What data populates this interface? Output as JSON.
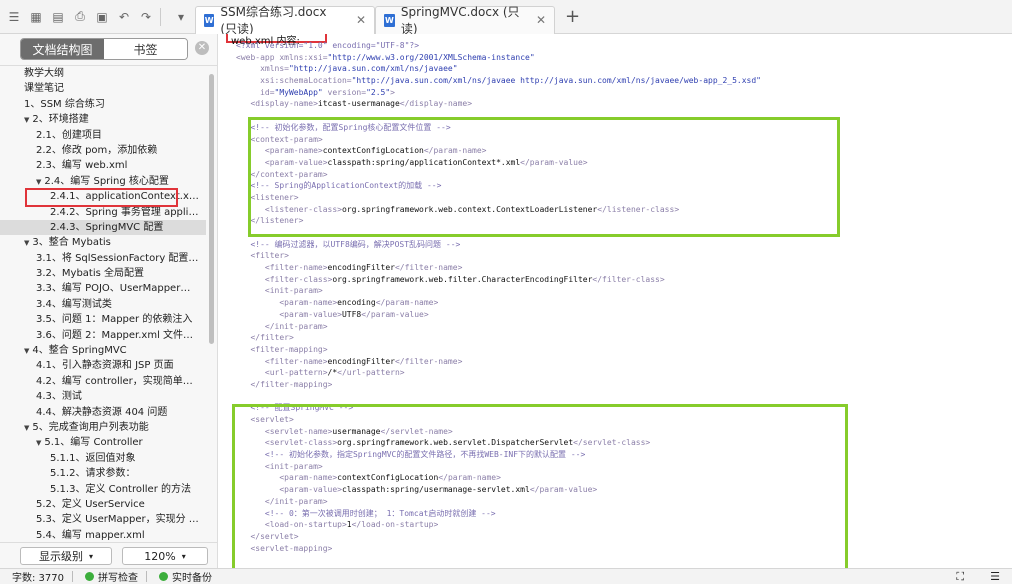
{
  "tabs": [
    {
      "label": "SSM综合练习.docx (只读)",
      "active": true
    },
    {
      "label": "SpringMVC.docx (只读)",
      "active": false
    }
  ],
  "sidebar": {
    "seg_outline": "文档结构图",
    "seg_bookmarks": "书签",
    "items": [
      {
        "label": "教学大纲",
        "level": 0,
        "caret": ""
      },
      {
        "label": "课堂笔记",
        "level": 0,
        "caret": ""
      },
      {
        "label": "1、SSM 综合练习",
        "level": 0,
        "caret": ""
      },
      {
        "label": "2、环境搭建",
        "level": 0,
        "caret": "▼"
      },
      {
        "label": "2.1、创建项目",
        "level": 1,
        "caret": ""
      },
      {
        "label": "2.2、修改 pom，添加依赖",
        "level": 1,
        "caret": ""
      },
      {
        "label": "2.3、编写 web.xml",
        "level": 1,
        "caret": ""
      },
      {
        "label": "2.4、编写 Spring 核心配置",
        "level": 1,
        "caret": "▼"
      },
      {
        "label": "2.4.1、applicationContext.xml",
        "level": 2,
        "caret": ""
      },
      {
        "label": "2.4.2、Spring 事务管理 applic…",
        "level": 2,
        "caret": ""
      },
      {
        "label": "2.4.3、SpringMVC 配置",
        "level": 2,
        "caret": "",
        "selected": true
      },
      {
        "label": "3、整合 Mybatis",
        "level": 0,
        "caret": "▼"
      },
      {
        "label": "3.1、将 SqlSessionFactory 配置 …",
        "level": 1,
        "caret": ""
      },
      {
        "label": "3.2、Mybatis 全局配置",
        "level": 1,
        "caret": ""
      },
      {
        "label": "3.3、编写 POJO、UserMapper、…",
        "level": 1,
        "caret": ""
      },
      {
        "label": "3.4、编写测试类",
        "level": 1,
        "caret": ""
      },
      {
        "label": "3.5、问题 1：Mapper 的依赖注入",
        "level": 1,
        "caret": ""
      },
      {
        "label": "3.6、问题 2：Mapper.xml 文件问…",
        "level": 1,
        "caret": ""
      },
      {
        "label": "4、整合 SpringMVC",
        "level": 0,
        "caret": "▼"
      },
      {
        "label": "4.1、引入静态资源和 JSP 页面",
        "level": 1,
        "caret": ""
      },
      {
        "label": "4.2、编写 controller，实现简单页…",
        "level": 1,
        "caret": ""
      },
      {
        "label": "4.3、测试",
        "level": 1,
        "caret": ""
      },
      {
        "label": "4.4、解决静态资源 404 问题",
        "level": 1,
        "caret": ""
      },
      {
        "label": "5、完成查询用户列表功能",
        "level": 0,
        "caret": "▼"
      },
      {
        "label": "5.1、编写 Controller",
        "level": 1,
        "caret": "▼"
      },
      {
        "label": "5.1.1、返回值对象",
        "level": 2,
        "caret": ""
      },
      {
        "label": "5.1.2、请求参数：",
        "level": 2,
        "caret": ""
      },
      {
        "label": "5.1.3、定义 Controller 的方法",
        "level": 2,
        "caret": ""
      },
      {
        "label": "5.2、定义 UserService",
        "level": 1,
        "caret": ""
      },
      {
        "label": "5.3、定义 UserMapper，实现分 …",
        "level": 1,
        "caret": ""
      },
      {
        "label": "5.4、编写 mapper.xml",
        "level": 1,
        "caret": ""
      }
    ],
    "level_select": "显示级别",
    "zoom_select": "120%"
  },
  "doc": {
    "heading": "web.xml 内容:",
    "lines": [
      [
        {
          "t": "c",
          "v": "<?xml version=\"1.0\" encoding=\"UTF-8\"?>"
        }
      ],
      [
        {
          "t": "t",
          "v": "<web-app "
        },
        {
          "t": "t",
          "v": "xmlns:xsi="
        },
        {
          "t": "s",
          "v": "\"http://www.w3.org/2001/XMLSchema-instance\""
        }
      ],
      [
        {
          "t": "t",
          "v": "     xmlns="
        },
        {
          "t": "s",
          "v": "\"http://java.sun.com/xml/ns/javaee\""
        }
      ],
      [
        {
          "t": "t",
          "v": "     xsi:schemaLocation="
        },
        {
          "t": "s",
          "v": "\"http://java.sun.com/xml/ns/javaee http://java.sun.com/xml/ns/javaee/web-app_2_5.xsd\""
        }
      ],
      [
        {
          "t": "t",
          "v": "     id="
        },
        {
          "t": "s",
          "v": "\"MyWebApp\""
        },
        {
          "t": "t",
          "v": " version="
        },
        {
          "t": "s",
          "v": "\"2.5\""
        },
        {
          "t": "t",
          "v": ">"
        }
      ],
      [
        {
          "t": "t",
          "v": "   <display-name>"
        },
        {
          "t": "x",
          "v": "itcast-usermanage"
        },
        {
          "t": "t",
          "v": "</display-name>"
        }
      ],
      [
        {
          "t": "x",
          "v": ""
        }
      ],
      [
        {
          "t": "c",
          "v": "   <!-- 初始化参数，配置Spring核心配置文件位置 -->"
        }
      ],
      [
        {
          "t": "t",
          "v": "   <context-param>"
        }
      ],
      [
        {
          "t": "t",
          "v": "      <param-name>"
        },
        {
          "t": "x",
          "v": "contextConfigLocation"
        },
        {
          "t": "t",
          "v": "</param-name>"
        }
      ],
      [
        {
          "t": "t",
          "v": "      <param-value>"
        },
        {
          "t": "x",
          "v": "classpath:spring/applicationContext*.xml"
        },
        {
          "t": "t",
          "v": "</param-value>"
        }
      ],
      [
        {
          "t": "t",
          "v": "   </context-param>"
        }
      ],
      [
        {
          "t": "c",
          "v": "   <!-- Spring的ApplicationContext的加载 -->"
        }
      ],
      [
        {
          "t": "t",
          "v": "   <listener>"
        }
      ],
      [
        {
          "t": "t",
          "v": "      <listener-class>"
        },
        {
          "t": "x",
          "v": "org.springframework.web.context.ContextLoaderListener"
        },
        {
          "t": "t",
          "v": "</listener-class>"
        }
      ],
      [
        {
          "t": "t",
          "v": "   </listener>"
        }
      ],
      [
        {
          "t": "x",
          "v": ""
        }
      ],
      [
        {
          "t": "c",
          "v": "   <!-- 编码过滤器，以UTF8编码，解决POST乱码问题 -->"
        }
      ],
      [
        {
          "t": "t",
          "v": "   <filter>"
        }
      ],
      [
        {
          "t": "t",
          "v": "      <filter-name>"
        },
        {
          "t": "x",
          "v": "encodingFilter"
        },
        {
          "t": "t",
          "v": "</filter-name>"
        }
      ],
      [
        {
          "t": "t",
          "v": "      <filter-class>"
        },
        {
          "t": "x",
          "v": "org.springframework.web.filter.CharacterEncodingFilter"
        },
        {
          "t": "t",
          "v": "</filter-class>"
        }
      ],
      [
        {
          "t": "t",
          "v": "      <init-param>"
        }
      ],
      [
        {
          "t": "t",
          "v": "         <param-name>"
        },
        {
          "t": "x",
          "v": "encoding"
        },
        {
          "t": "t",
          "v": "</param-name>"
        }
      ],
      [
        {
          "t": "t",
          "v": "         <param-value>"
        },
        {
          "t": "x",
          "v": "UTF8"
        },
        {
          "t": "t",
          "v": "</param-value>"
        }
      ],
      [
        {
          "t": "t",
          "v": "      </init-param>"
        }
      ],
      [
        {
          "t": "t",
          "v": "   </filter>"
        }
      ],
      [
        {
          "t": "t",
          "v": "   <filter-mapping>"
        }
      ],
      [
        {
          "t": "t",
          "v": "      <filter-name>"
        },
        {
          "t": "x",
          "v": "encodingFilter"
        },
        {
          "t": "t",
          "v": "</filter-name>"
        }
      ],
      [
        {
          "t": "t",
          "v": "      <url-pattern>"
        },
        {
          "t": "x",
          "v": "/*"
        },
        {
          "t": "t",
          "v": "</url-pattern>"
        }
      ],
      [
        {
          "t": "t",
          "v": "   </filter-mapping>"
        }
      ],
      [
        {
          "t": "x",
          "v": ""
        }
      ],
      [
        {
          "t": "c",
          "v": "   <!-- 配置SpringMVC -->"
        }
      ],
      [
        {
          "t": "t",
          "v": "   <servlet>"
        }
      ],
      [
        {
          "t": "t",
          "v": "      <servlet-name>"
        },
        {
          "t": "x",
          "v": "usermanage"
        },
        {
          "t": "t",
          "v": "</servlet-name>"
        }
      ],
      [
        {
          "t": "t",
          "v": "      <servlet-class>"
        },
        {
          "t": "x",
          "v": "org.springframework.web.servlet.DispatcherServlet"
        },
        {
          "t": "t",
          "v": "</servlet-class>"
        }
      ],
      [
        {
          "t": "c",
          "v": "      <!-- 初始化参数，指定SpringMVC的配置文件路径，不再找WEB-INF下的默认配置 -->"
        }
      ],
      [
        {
          "t": "t",
          "v": "      <init-param>"
        }
      ],
      [
        {
          "t": "t",
          "v": "         <param-name>"
        },
        {
          "t": "x",
          "v": "contextConfigLocation"
        },
        {
          "t": "t",
          "v": "</param-name>"
        }
      ],
      [
        {
          "t": "t",
          "v": "         <param-value>"
        },
        {
          "t": "x",
          "v": "classpath:spring/usermanage-servlet.xml"
        },
        {
          "t": "t",
          "v": "</param-value>"
        }
      ],
      [
        {
          "t": "t",
          "v": "      </init-param>"
        }
      ],
      [
        {
          "t": "c",
          "v": "      <!-- 0：第一次被调用时创建； 1：Tomcat启动时就创建 -->"
        }
      ],
      [
        {
          "t": "t",
          "v": "      <load-on-startup>"
        },
        {
          "t": "x",
          "v": "1"
        },
        {
          "t": "t",
          "v": "</load-on-startup>"
        }
      ],
      [
        {
          "t": "t",
          "v": "   </servlet>"
        }
      ],
      [
        {
          "t": "t",
          "v": "   <servlet-mapping>"
        }
      ]
    ]
  },
  "status": {
    "word_count": "字数: 3770",
    "spell_check": "拼写检查",
    "auto_backup": "实时备份"
  },
  "colors": {
    "highlight_red": "#e0343a",
    "highlight_green": "#86cc2b",
    "status_green": "#3cae3c"
  }
}
